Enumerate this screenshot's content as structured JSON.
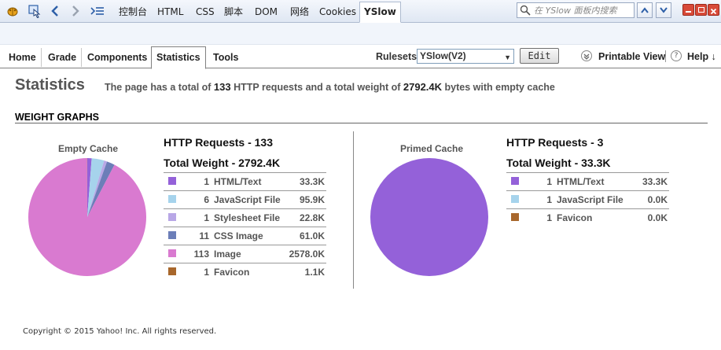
{
  "firebug": {
    "tabs": [
      "控制台",
      "HTML",
      "CSS",
      "脚本",
      "DOM",
      "网络",
      "Cookies",
      "YSlow"
    ],
    "active_tab": "YSlow",
    "search_placeholder": "在 YSlow 面板内搜索"
  },
  "yslow": {
    "tabs": [
      "Home",
      "Grade",
      "Components",
      "Statistics",
      "Tools"
    ],
    "active_tab": "Statistics",
    "rulesets_label": "Rulesets",
    "ruleset_value": "YSlow(V2)",
    "edit_label": "Edit",
    "printable_view_label": "Printable View",
    "help_label": "Help ↓"
  },
  "stats": {
    "title": "Statistics",
    "summary": {
      "prefix": "The page has a total of",
      "requests": "133",
      "mid": "HTTP requests and a total weight of",
      "weight": "2792.4K",
      "suffix": "bytes with empty cache"
    },
    "weight_graphs_title": "WEIGHT GRAPHS"
  },
  "empty_cache": {
    "label": "Empty Cache",
    "http_requests": "HTTP Requests - 133",
    "total_weight": "Total Weight - 2792.4K",
    "rows": [
      {
        "color": "#9461d9",
        "count": "1",
        "type": "HTML/Text",
        "size": "33.3K"
      },
      {
        "color": "#a6d3ec",
        "count": "6",
        "type": "JavaScript File",
        "size": "95.9K"
      },
      {
        "color": "#b8a7e6",
        "count": "1",
        "type": "Stylesheet File",
        "size": "22.8K"
      },
      {
        "color": "#6c7eb8",
        "count": "11",
        "type": "CSS Image",
        "size": "61.0K"
      },
      {
        "color": "#d97ad0",
        "count": "113",
        "type": "Image",
        "size": "2578.0K"
      },
      {
        "color": "#a8672c",
        "count": "1",
        "type": "Favicon",
        "size": "1.1K"
      }
    ]
  },
  "primed_cache": {
    "label": "Primed Cache",
    "http_requests": "HTTP Requests - 3",
    "total_weight": "Total Weight - 33.3K",
    "rows": [
      {
        "color": "#9461d9",
        "count": "1",
        "type": "HTML/Text",
        "size": "33.3K"
      },
      {
        "color": "#a6d3ec",
        "count": "1",
        "type": "JavaScript File",
        "size": "0.0K"
      },
      {
        "color": "#a8672c",
        "count": "1",
        "type": "Favicon",
        "size": "0.0K"
      }
    ]
  },
  "chart_data": [
    {
      "type": "pie",
      "title": "Empty Cache",
      "categories": [
        "HTML/Text",
        "JavaScript File",
        "Stylesheet File",
        "CSS Image",
        "Image",
        "Favicon"
      ],
      "values": [
        33.3,
        95.9,
        22.8,
        61.0,
        2578.0,
        1.1
      ],
      "colors": [
        "#9461d9",
        "#a6d3ec",
        "#b8a7e6",
        "#6c7eb8",
        "#d97ad0",
        "#a8672c"
      ]
    },
    {
      "type": "pie",
      "title": "Primed Cache",
      "categories": [
        "HTML/Text",
        "JavaScript File",
        "Favicon"
      ],
      "values": [
        33.3,
        0.0,
        0.0
      ],
      "colors": [
        "#9461d9",
        "#a6d3ec",
        "#a8672c"
      ]
    }
  ],
  "footer": {
    "copyright": "Copyright © 2015 Yahoo! Inc. All rights reserved."
  }
}
